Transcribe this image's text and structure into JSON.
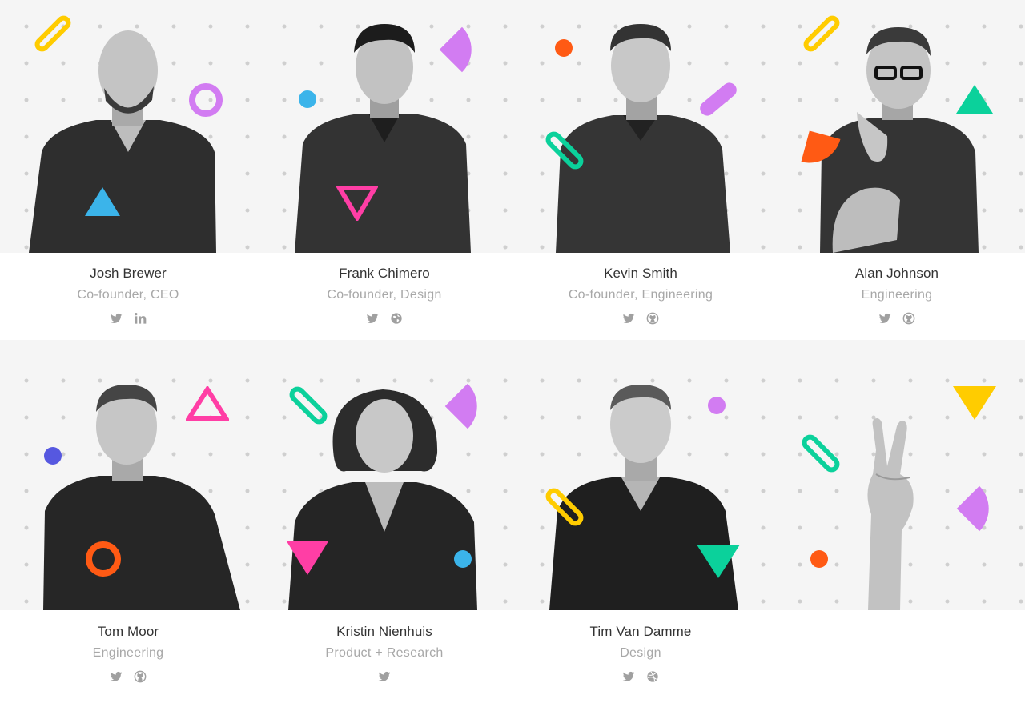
{
  "colors": {
    "yellow": "#ffcc00",
    "purple": "#d27cf2",
    "blue": "#3bb4ea",
    "pink": "#ff3ea5",
    "teal": "#0bd19b",
    "orange": "#ff5a14",
    "indigo": "#5658e0",
    "icon_gray": "#a0a0a0",
    "name_color": "#333333",
    "role_color": "#a8a8a8"
  },
  "team": [
    {
      "name": "Josh Brewer",
      "role": "Co-founder, CEO",
      "socials": [
        "twitter-icon",
        "linkedin-icon"
      ]
    },
    {
      "name": "Frank Chimero",
      "role": "Co-founder, Design",
      "socials": [
        "twitter-icon",
        "globe-icon"
      ]
    },
    {
      "name": "Kevin Smith",
      "role": "Co-founder, Engineering",
      "socials": [
        "twitter-icon",
        "github-icon"
      ]
    },
    {
      "name": "Alan Johnson",
      "role": "Engineering",
      "socials": [
        "twitter-icon",
        "github-icon"
      ]
    },
    {
      "name": "Tom Moor",
      "role": "Engineering",
      "socials": [
        "twitter-icon",
        "github-icon"
      ]
    },
    {
      "name": "Kristin Nienhuis",
      "role": "Product + Research",
      "socials": [
        "twitter-icon"
      ]
    },
    {
      "name": "Tim Van Damme",
      "role": "Design",
      "socials": [
        "twitter-icon",
        "dribbble-icon"
      ]
    }
  ],
  "peace_card": {
    "image": "peace-sign-hand"
  }
}
